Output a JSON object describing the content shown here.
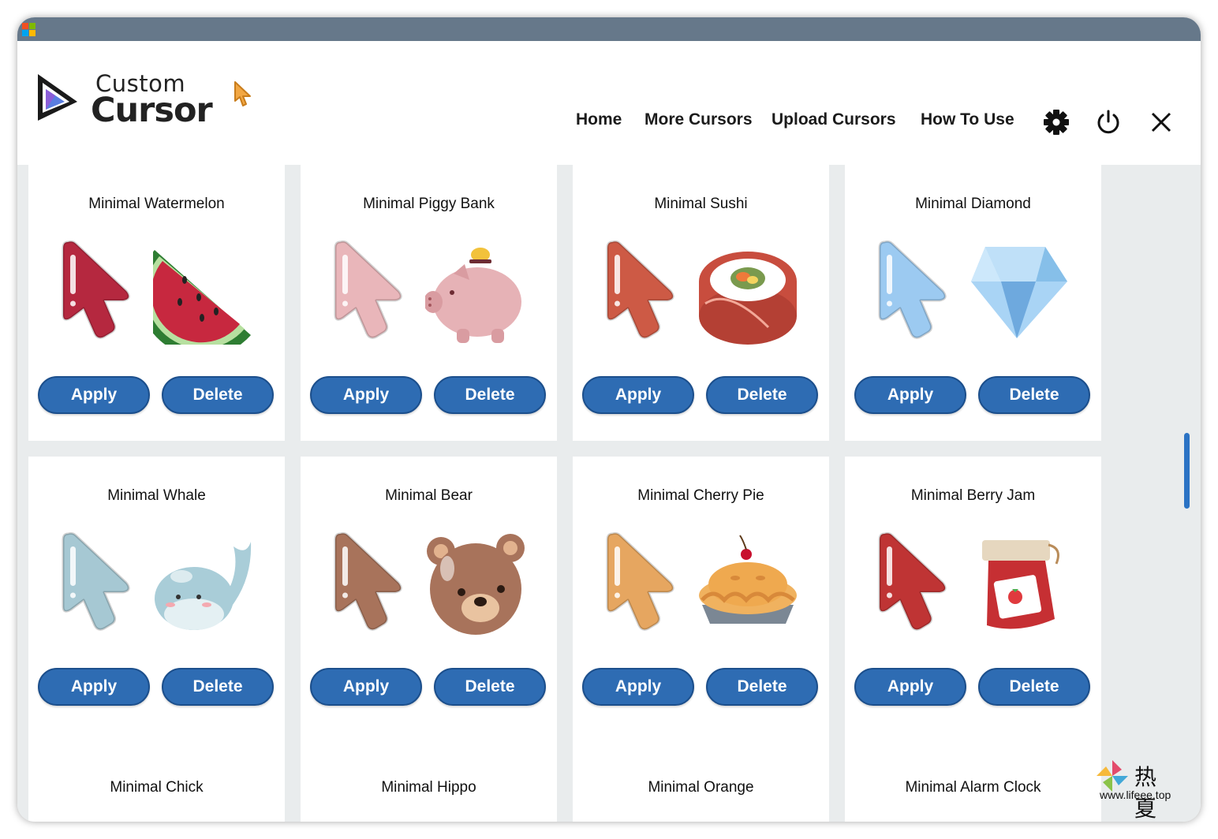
{
  "logo": {
    "line1": "Custom",
    "line2": "Cursor"
  },
  "nav": {
    "home": "Home",
    "more": "More Cursors",
    "upload": "Upload Cursors",
    "howto": "How To Use"
  },
  "header_icons": [
    "gear-icon",
    "power-icon",
    "close-icon"
  ],
  "colors": {
    "titlebar": "#66788a",
    "button": "#2e6cb3",
    "content_bg": "#e9eced",
    "scroll": "#2b73c4"
  },
  "buttons": {
    "apply": "Apply",
    "delete": "Delete"
  },
  "cards": [
    {
      "title": "Minimal Watermelon",
      "art": "watermelon",
      "cursor_color": "#b5283f"
    },
    {
      "title": "Minimal Piggy Bank",
      "art": "piggy",
      "cursor_color": "#e9b6ba"
    },
    {
      "title": "Minimal Sushi",
      "art": "sushi",
      "cursor_color": "#cd5a45"
    },
    {
      "title": "Minimal Diamond",
      "art": "diamond",
      "cursor_color": "#9ccaf1"
    },
    {
      "title": "Minimal Whale",
      "art": "whale",
      "cursor_color": "#a6c8d3"
    },
    {
      "title": "Minimal Bear",
      "art": "bear",
      "cursor_color": "#a8735b"
    },
    {
      "title": "Minimal Cherry Pie",
      "art": "pie",
      "cursor_color": "#e6a660"
    },
    {
      "title": "Minimal Berry Jam",
      "art": "jam",
      "cursor_color": "#bf3434"
    },
    {
      "title": "Minimal Chick",
      "art": "",
      "cursor_color": ""
    },
    {
      "title": "Minimal Hippo",
      "art": "",
      "cursor_color": ""
    },
    {
      "title": "Minimal Orange",
      "art": "",
      "cursor_color": ""
    },
    {
      "title": "Minimal Alarm Clock",
      "art": "",
      "cursor_color": ""
    }
  ],
  "watermark": {
    "cn": "热夏",
    "url": "www.lifeee.top"
  }
}
